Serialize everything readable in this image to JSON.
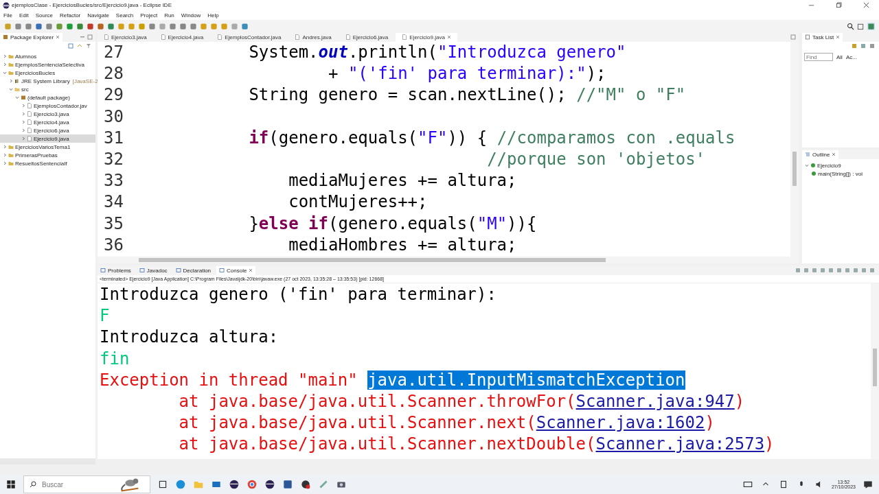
{
  "window": {
    "title": "ejemplosClase - EjerciciosBucles/src/Ejercicio9.java - Eclipse IDE"
  },
  "menu": [
    "File",
    "Edit",
    "Source",
    "Refactor",
    "Navigate",
    "Search",
    "Project",
    "Run",
    "Window",
    "Help"
  ],
  "package_explorer": {
    "title": "Package Explorer",
    "items": [
      {
        "label": "Alumnos",
        "kind": "project",
        "expanded": false,
        "selected": false
      },
      {
        "label": "EjemplosSentenciaSelectiva",
        "kind": "project",
        "expanded": false,
        "selected": false
      },
      {
        "label": "EjerciciosBucles",
        "kind": "project",
        "expanded": true,
        "selected": false,
        "children": [
          {
            "label": "JRE System Library",
            "decoration": "[JavaSE-2",
            "kind": "library",
            "expanded": false,
            "selected": false
          },
          {
            "label": "src",
            "kind": "folder",
            "expanded": true,
            "selected": false,
            "children": [
              {
                "label": "(default package)",
                "kind": "package",
                "expanded": true,
                "selected": false,
                "children": [
                  {
                    "label": "EjemplosContador.jav",
                    "kind": "file",
                    "expanded": false,
                    "selected": false
                  },
                  {
                    "label": "Ejercicio3.java",
                    "kind": "file",
                    "expanded": false,
                    "selected": false
                  },
                  {
                    "label": "Ejercicio4.java",
                    "kind": "file",
                    "expanded": false,
                    "selected": false
                  },
                  {
                    "label": "Ejercicio6.java",
                    "kind": "file",
                    "expanded": false,
                    "selected": false
                  },
                  {
                    "label": "Ejercicio9.java",
                    "kind": "file",
                    "expanded": false,
                    "selected": true
                  }
                ]
              }
            ]
          }
        ]
      },
      {
        "label": "EjerciciosVariosTema1",
        "kind": "project",
        "expanded": false,
        "selected": false
      },
      {
        "label": "PrimerasPruebas",
        "kind": "project",
        "expanded": false,
        "selected": false
      },
      {
        "label": "ResueltosSentenciaIf",
        "kind": "project",
        "expanded": false,
        "selected": false
      }
    ]
  },
  "editor": {
    "tabs": [
      {
        "label": "Ejercicio3.java",
        "selected": false
      },
      {
        "label": "Ejercicio4.java",
        "selected": false
      },
      {
        "label": "EjemplosContador.java",
        "selected": false
      },
      {
        "label": "Andres.java",
        "selected": false
      },
      {
        "label": "Ejercicio6.java",
        "selected": false
      },
      {
        "label": "Ejercicio9.java",
        "selected": true
      }
    ],
    "lines": [
      {
        "number": "27",
        "segments": [
          {
            "text": "            System.",
            "kind": "plain"
          },
          {
            "text": "out",
            "kind": "field"
          },
          {
            "text": ".println(",
            "kind": "plain"
          },
          {
            "text": "\"Introduzca genero\"",
            "kind": "string"
          }
        ]
      },
      {
        "number": "28",
        "segments": [
          {
            "text": "                    + ",
            "kind": "plain"
          },
          {
            "text": "\"('fin' para terminar):\"",
            "kind": "string"
          },
          {
            "text": ");",
            "kind": "plain"
          }
        ]
      },
      {
        "number": "29",
        "segments": [
          {
            "text": "            String genero = scan.nextLine(); ",
            "kind": "plain"
          },
          {
            "text": "//\"M\" o \"F\"",
            "kind": "comment"
          }
        ]
      },
      {
        "number": "30"
      },
      {
        "number": "31",
        "segments": [
          {
            "text": "            if",
            "kind": "keyword"
          },
          {
            "text": "(genero.equals(",
            "kind": "plain"
          },
          {
            "text": "\"F\"",
            "kind": "string"
          },
          {
            "text": ")) { ",
            "kind": "plain"
          },
          {
            "text": "//comparamos con .equals",
            "kind": "comment"
          }
        ]
      },
      {
        "number": "32",
        "segments": [
          {
            "text": "                                    //porque son 'objetos'",
            "kind": "comment"
          }
        ]
      },
      {
        "number": "33",
        "segments": [
          {
            "text": "                mediaMujeres += altura;",
            "kind": "plain"
          }
        ]
      },
      {
        "number": "34",
        "segments": [
          {
            "text": "                contMujeres++;",
            "kind": "plain"
          }
        ]
      },
      {
        "number": "35",
        "segments": [
          {
            "text": "            }",
            "kind": "plain"
          },
          {
            "text": "else",
            "kind": "keyword"
          },
          {
            "text": " if",
            "kind": "keyword"
          },
          {
            "text": "(genero.equals(",
            "kind": "plain"
          },
          {
            "text": "\"M\"",
            "kind": "string"
          },
          {
            "text": ")){",
            "kind": "plain"
          }
        ]
      },
      {
        "number": "36",
        "segments": [
          {
            "text": "                mediaHombres += altura;",
            "kind": "plain"
          }
        ]
      }
    ]
  },
  "task_list": {
    "title": "Task List",
    "find": {
      "placeholder": "Find"
    },
    "filters": [
      "All",
      "Ac..."
    ]
  },
  "outline": {
    "title": "Outline",
    "items": [
      {
        "label": "Ejercicio9",
        "expanded": true,
        "children": [
          {
            "label": "main(String[]) : voi"
          }
        ]
      }
    ]
  },
  "console": {
    "tabs": [
      {
        "label": "Problems",
        "selected": false
      },
      {
        "label": "Javadoc",
        "selected": false
      },
      {
        "label": "Declaration",
        "selected": false
      },
      {
        "label": "Console",
        "selected": true
      }
    ],
    "status": "<terminated> Ejercicio9 [Java Application] C:\\Program Files\\Java\\jdk-20\\bin\\javaw.exe  (27 oct 2023, 13:35:28 – 13:35:53) [pid: 12668]",
    "lines": [
      {
        "kind": "output",
        "segments": [
          {
            "text": "Introduzca genero ('fin' para terminar):",
            "kind": "plain"
          }
        ]
      },
      {
        "kind": "input",
        "segments": [
          {
            "text": "F",
            "kind": "plain"
          }
        ]
      },
      {
        "kind": "output",
        "segments": [
          {
            "text": "Introduzca altura:",
            "kind": "plain"
          }
        ]
      },
      {
        "kind": "input",
        "segments": [
          {
            "text": "fin",
            "kind": "plain"
          }
        ]
      },
      {
        "kind": "error",
        "segments": [
          {
            "text": "Exception in thread \"main\" ",
            "kind": "plain"
          },
          {
            "text": "java.util.InputMismatchException",
            "kind": "selected"
          }
        ]
      },
      {
        "kind": "error",
        "segments": [
          {
            "text": "        at java.base/java.util.Scanner.throwFor(",
            "kind": "plain"
          },
          {
            "text": "Scanner.java:947",
            "kind": "link"
          },
          {
            "text": ")",
            "kind": "plain"
          }
        ]
      },
      {
        "kind": "error",
        "segments": [
          {
            "text": "        at java.base/java.util.Scanner.next(",
            "kind": "plain"
          },
          {
            "text": "Scanner.java:1602",
            "kind": "link"
          },
          {
            "text": ")",
            "kind": "plain"
          }
        ]
      },
      {
        "kind": "error",
        "segments": [
          {
            "text": "        at java.base/java.util.Scanner.nextDouble(",
            "kind": "plain"
          },
          {
            "text": "Scanner.java:2573",
            "kind": "link"
          },
          {
            "text": ")",
            "kind": "plain"
          }
        ]
      }
    ]
  },
  "taskbar": {
    "search": {
      "placeholder": "Buscar"
    },
    "time": "13:52",
    "date": "27/10/2023"
  }
}
